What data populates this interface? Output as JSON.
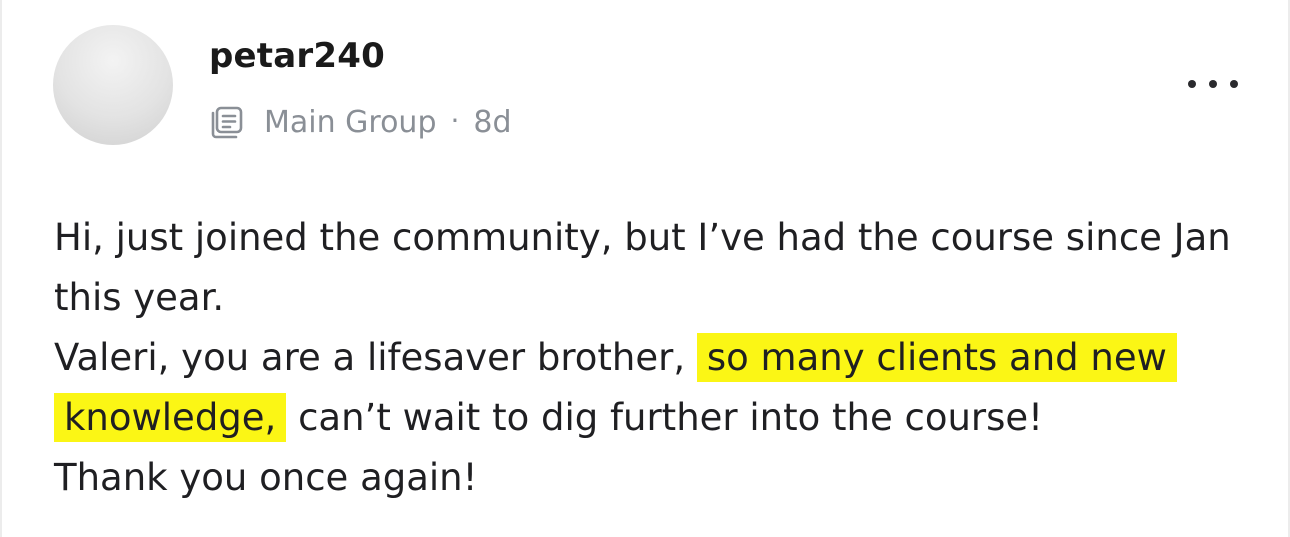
{
  "post": {
    "author": "petar240",
    "group_icon": "post-group-icon",
    "group": "Main Group",
    "separator": "·",
    "age": "8d",
    "menu_icon": "more-dots-icon",
    "body": {
      "line1": "Hi, just joined the community, but I’ve had the course since Jan this year.",
      "line2_before": "Valeri, you are a lifesaver brother,",
      "line2_highlight": "so many clients and new knowledge,",
      "line2_after": "can’t wait to dig further into the course!",
      "line3": "Thank you once again!"
    },
    "highlight_color": "#fbf615",
    "meta_color": "#8a8f96"
  }
}
